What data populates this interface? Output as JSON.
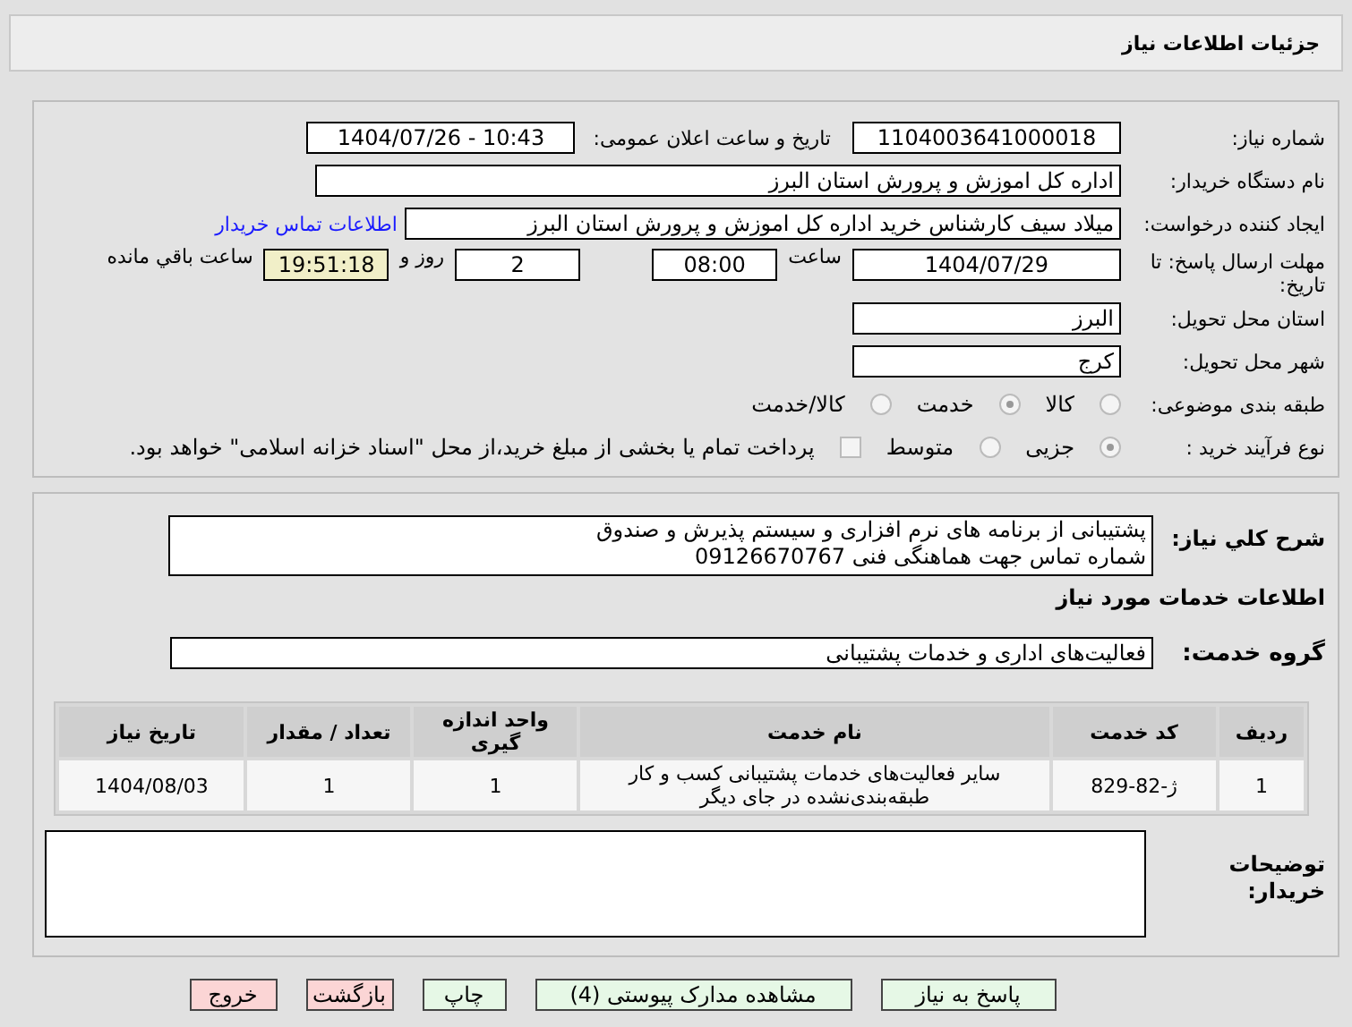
{
  "window": {
    "title": "جزئیات اطلاعات نیاز"
  },
  "need_number": {
    "label": "شماره نیاز:",
    "value": "1104003641000018"
  },
  "announce": {
    "label": "تاریخ و ساعت اعلان عمومی:",
    "value": "1404/07/26 - 10:43"
  },
  "buyer_org": {
    "label": "نام دستگاه خریدار:",
    "value": "اداره کل اموزش و پرورش استان البرز"
  },
  "creator": {
    "label": "ایجاد کننده درخواست:",
    "value": "میلاد  سیف  کارشناس خرید  اداره کل اموزش و پرورش استان البرز",
    "link": "اطلاعات تماس خریدار"
  },
  "deadline": {
    "label": "مهلت ارسال پاسخ: تا تاریخ:",
    "date": "1404/07/29",
    "time_label": "ساعت",
    "time": "08:00",
    "days": "2",
    "days_label": "روز و",
    "remaining": "19:51:18",
    "remaining_label": "ساعت باقي مانده"
  },
  "province": {
    "label": "استان محل تحویل:",
    "value": "البرز"
  },
  "city": {
    "label": "شهر محل تحویل:",
    "value": "کرج"
  },
  "category": {
    "label": "طبقه بندی موضوعی:",
    "options": [
      {
        "label": "کالا",
        "selected": false
      },
      {
        "label": "خدمت",
        "selected": true
      },
      {
        "label": "کالا/خدمت",
        "selected": false
      }
    ]
  },
  "process": {
    "label": "نوع فرآیند خرید :",
    "options": [
      {
        "label": "جزیی",
        "selected": true
      },
      {
        "label": "متوسط",
        "selected": false
      }
    ],
    "payment": {
      "label": "پرداخت تمام یا بخشی از مبلغ خرید،از محل \"اسناد خزانه اسلامی\" خواهد بود.",
      "checked": false
    }
  },
  "description": {
    "label": "شرح کلي نیاز:",
    "value": "پشتیبانی از برنامه های نرم افزاری و سیستم پذیرش و صندوق\nشماره تماس جهت هماهنگی فنی 09126670767"
  },
  "services_title": "اطلاعات خدمات مورد نیاز",
  "service_group": {
    "label": "گروه خدمت:",
    "value": "فعالیت‌های اداری و خدمات پشتیبانی"
  },
  "table": {
    "columns": [
      "ردیف",
      "کد خدمت",
      "نام خدمت",
      "واحد اندازه گیری",
      "تعداد / مقدار",
      "تاریخ نیاز"
    ],
    "rows": [
      [
        "1",
        "ژ-82-829",
        "سایر فعالیت‌های خدمات پشتیبانی کسب و کار طبقه‌بندی‌نشده در جای دیگر",
        "1",
        "1",
        "1404/08/03"
      ]
    ]
  },
  "buyer_notes": {
    "label": "توضیحات خریدار:"
  },
  "buttons": [
    {
      "label": "پاسخ به نیاز",
      "kind": "action"
    },
    {
      "label": "مشاهده مدارک پیوستی (4)",
      "kind": "action"
    },
    {
      "label": "چاپ",
      "kind": "action"
    },
    {
      "label": "بازگشت",
      "kind": "exit"
    },
    {
      "label": "خروج",
      "kind": "exit"
    }
  ]
}
